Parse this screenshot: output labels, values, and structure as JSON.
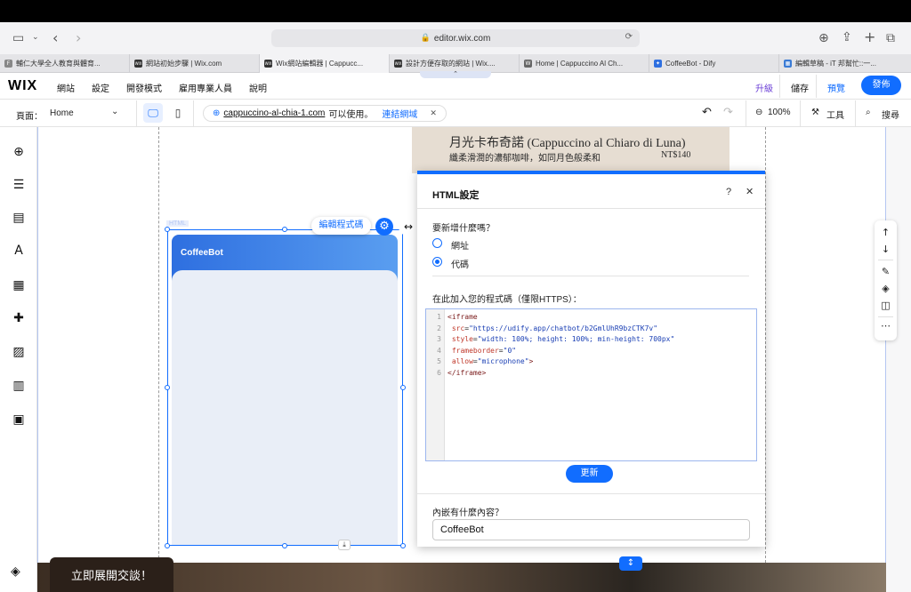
{
  "browser": {
    "url": "editor.wix.com",
    "tabs": [
      {
        "icon": "F",
        "label": "輔仁大學全人教育與體育..."
      },
      {
        "icon": "WIX",
        "label": "網站初始步驟 | Wix.com"
      },
      {
        "icon": "WIX",
        "label": "Wix網站編輯器 | Cappucc..."
      },
      {
        "icon": "WIX",
        "label": "設計方便存取的網站 | Wix...."
      },
      {
        "icon": "W",
        "label": "Home | Cappuccino Al Ch..."
      },
      {
        "icon": "✦",
        "label": "CoffeeBot - Dify"
      },
      {
        "icon": "▦",
        "label": "編輯草稿 - iT 邦幫忙::一..."
      }
    ]
  },
  "wix": {
    "logo": "WIX",
    "menu": [
      "網站",
      "設定",
      "開發模式",
      "雇用專業人員",
      "說明"
    ],
    "upgrade": "升級",
    "save": "儲存",
    "preview": "預覽",
    "publish": "發佈"
  },
  "pagebar": {
    "page_label": "頁面：",
    "page_value": "Home",
    "domain": "cappuccino-al-chia-1.com",
    "domain_status": "可以使用。",
    "connect": "連結網域",
    "zoom": "100%",
    "tools": "工具",
    "search": "搜尋"
  },
  "canvas": {
    "menu_item_name": "月光卡布奇諾 (Cappuccino al Chiaro di Luna)",
    "menu_item_desc": "纖柔滑潤的濃郁咖啡，如同月色般柔和",
    "menu_item_price": "NT$140",
    "html_tag": "HTML",
    "edit_code": "編輯程式碼",
    "bot_title": "CoffeeBot",
    "expand_chat": "立即展開交談！"
  },
  "panel": {
    "title": "HTML設定",
    "help": "?",
    "question": "要新增什麼嗎？",
    "option_url": "網址",
    "option_code": "代碼",
    "selected": "代碼",
    "code_label": "在此加入您的程式碼（僅限HTTPS）：",
    "code_lines": [
      {
        "n": "1",
        "parts": [
          [
            "tag",
            "<iframe"
          ]
        ]
      },
      {
        "n": "2",
        "parts": [
          [
            "attr",
            " src"
          ],
          [
            "plain",
            "="
          ],
          [
            "val",
            "\"https://udify.app/chatbot/b2GmlUhR9bzCTK7v\""
          ]
        ]
      },
      {
        "n": "3",
        "parts": [
          [
            "attr",
            " style"
          ],
          [
            "plain",
            "="
          ],
          [
            "val",
            "\"width: 100%; height: 100%; min-height: 700px\""
          ]
        ]
      },
      {
        "n": "4",
        "parts": [
          [
            "attr",
            " frameborder"
          ],
          [
            "plain",
            "="
          ],
          [
            "val",
            "\"0\""
          ]
        ]
      },
      {
        "n": "5",
        "parts": [
          [
            "attr",
            " allow"
          ],
          [
            "plain",
            "="
          ],
          [
            "val",
            "\"microphone\""
          ],
          [
            "tag",
            ">"
          ]
        ]
      },
      {
        "n": "6",
        "parts": [
          [
            "tag",
            "</iframe>"
          ]
        ]
      }
    ],
    "update": "更新",
    "embed_label": "內嵌有什麼內容？",
    "embed_value": "CoffeeBot"
  },
  "colors": {
    "accent": "#116dff",
    "bot_gradient_start": "#2e6fe0",
    "bot_gradient_end": "#5a9ef0"
  }
}
